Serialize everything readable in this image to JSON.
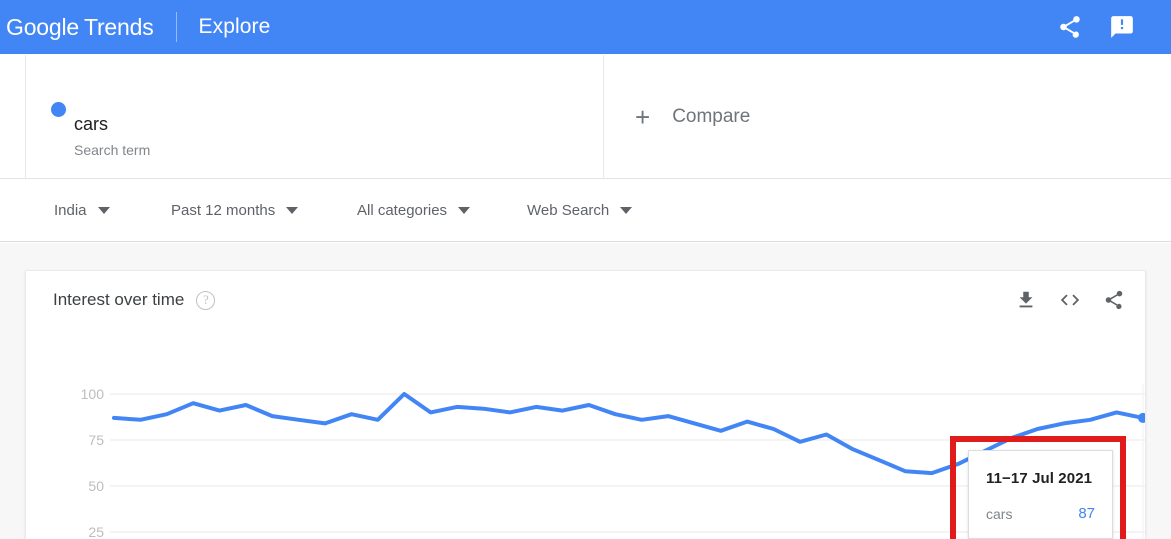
{
  "appbar": {
    "brand_google": "Google",
    "brand_trends": "Trends",
    "explore": "Explore",
    "share_icon": "share-icon",
    "feedback_icon": "feedback-icon",
    "background_color": "#4285f4"
  },
  "query": {
    "term": "cars",
    "term_type": "Search term",
    "dot_color": "#4285f4",
    "compare_label": "Compare",
    "compare_plus": "+"
  },
  "filters": [
    {
      "label": "India"
    },
    {
      "label": "Past 12 months"
    },
    {
      "label": "All categories"
    },
    {
      "label": "Web Search"
    }
  ],
  "chart_card": {
    "title": "Interest over time",
    "help_icon": "help-icon",
    "help_glyph": "?",
    "download_icon": "download-icon",
    "embed_icon": "embed-code-icon",
    "share_icon": "share-icon"
  },
  "tooltip": {
    "date": "11−17 Jul 2021",
    "series": "cars",
    "value": "87",
    "value_color": "#4285f4"
  },
  "annotation": {
    "color": "#e01b1b"
  },
  "chart_data": {
    "type": "line",
    "title": "Interest over time",
    "xlabel": "",
    "ylabel": "",
    "ylim": [
      0,
      110
    ],
    "yticks": [
      100,
      75,
      50,
      25
    ],
    "ytick_labels": [
      "100",
      "75",
      "50",
      "25"
    ],
    "grid": true,
    "legend": "none",
    "line_color": "#4285f4",
    "series": [
      {
        "name": "cars",
        "values": [
          87,
          86,
          89,
          95,
          91,
          94,
          88,
          86,
          84,
          89,
          86,
          100,
          90,
          93,
          92,
          90,
          93,
          91,
          94,
          89,
          86,
          88,
          84,
          80,
          85,
          81,
          74,
          78,
          70,
          64,
          58,
          57,
          62,
          69,
          76,
          81,
          84,
          86,
          90,
          87
        ]
      }
    ],
    "highlighted_point": {
      "label": "11−17 Jul 2021",
      "series": "cars",
      "value": 87
    },
    "end_marker": true
  }
}
